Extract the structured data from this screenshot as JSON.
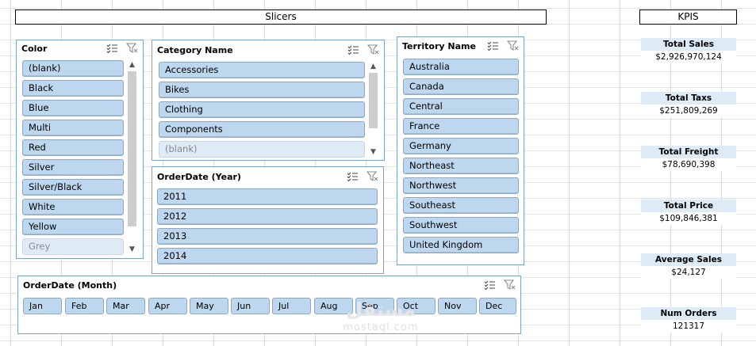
{
  "banners": {
    "slicers": "Slicers",
    "kpis": "KPIS"
  },
  "colors": {
    "item_fill": "#bdd7ee",
    "border": "#7aa2c7",
    "kpi_header": "#ddebf7"
  },
  "icons": {
    "multi_select": "multi-select-icon",
    "clear_filter": "clear-filter-icon"
  },
  "color_slicer": {
    "title": "Color",
    "items": [
      "(blank)",
      "Black",
      "Blue",
      "Multi",
      "Red",
      "Silver",
      "Silver/Black",
      "White",
      "Yellow",
      "Grey"
    ]
  },
  "category_slicer": {
    "title": "Category Name",
    "items": [
      "Accessories",
      "Bikes",
      "Clothing",
      "Components",
      "(blank)"
    ]
  },
  "year_slicer": {
    "title": "OrderDate (Year)",
    "items": [
      "2011",
      "2012",
      "2013",
      "2014"
    ]
  },
  "territory_slicer": {
    "title": "Territory Name",
    "items": [
      "Australia",
      "Canada",
      "Central",
      "France",
      "Germany",
      "Northeast",
      "Northwest",
      "Southeast",
      "Southwest",
      "United Kingdom"
    ]
  },
  "month_slicer": {
    "title": "OrderDate (Month)",
    "items": [
      "Jan",
      "Feb",
      "Mar",
      "Apr",
      "May",
      "Jun",
      "Jul",
      "Aug",
      "Sep",
      "Oct",
      "Nov",
      "Dec"
    ]
  },
  "kpis": [
    {
      "label": "Total Sales",
      "value": "$2,926,970,124"
    },
    {
      "label": "Total Taxs",
      "value": "$251,809,269"
    },
    {
      "label": "Total Freight",
      "value": "$78,690,398"
    },
    {
      "label": "Total Price",
      "value": "$109,846,381"
    },
    {
      "label": "Average Sales",
      "value": "$24,127"
    },
    {
      "label": "Num Orders",
      "value": "121317"
    }
  ],
  "watermark": {
    "arabic": "مستقل",
    "latin": "mostaql.com"
  }
}
